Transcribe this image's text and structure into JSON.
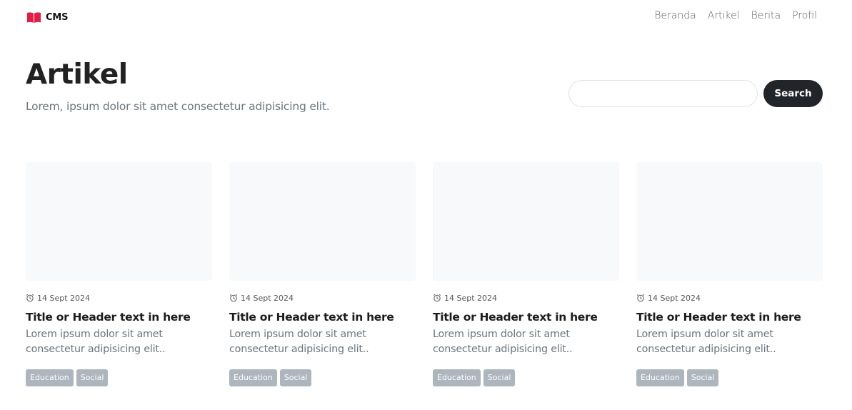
{
  "navbar": {
    "brand": "CMS",
    "brand_icon": "open-book-icon",
    "brand_color": "#e11d48",
    "links": [
      "Beranda",
      "Artikel",
      "Berita",
      "Profil"
    ]
  },
  "hero": {
    "title": "Artikel",
    "subtitle": "Lorem, ipsum dolor sit amet consectetur adipisicing elit."
  },
  "search": {
    "placeholder": "",
    "button_label": "Search"
  },
  "cards": [
    {
      "date_icon": "alarm-clock-icon",
      "date": "14 Sept 2024",
      "title": "Title or Header text in here",
      "text": "Lorem ipsum dolor sit amet consectetur adipisicing elit..",
      "tags": [
        "Education",
        "Social"
      ]
    },
    {
      "date_icon": "alarm-clock-icon",
      "date": "14 Sept 2024",
      "title": "Title or Header text in here",
      "text": "Lorem ipsum dolor sit amet consectetur adipisicing elit..",
      "tags": [
        "Education",
        "Social"
      ]
    },
    {
      "date_icon": "alarm-clock-icon",
      "date": "14 Sept 2024",
      "title": "Title or Header text in here",
      "text": "Lorem ipsum dolor sit amet consectetur adipisicing elit..",
      "tags": [
        "Education",
        "Social"
      ]
    },
    {
      "date_icon": "alarm-clock-icon",
      "date": "14 Sept 2024",
      "title": "Title or Header text in here",
      "text": "Lorem ipsum dolor sit amet consectetur adipisicing elit..",
      "tags": [
        "Education",
        "Social"
      ]
    }
  ],
  "colors": {
    "button_bg": "#212529",
    "tag_bg": "#adb5bd",
    "card_image_bg": "#f8f9fa"
  }
}
